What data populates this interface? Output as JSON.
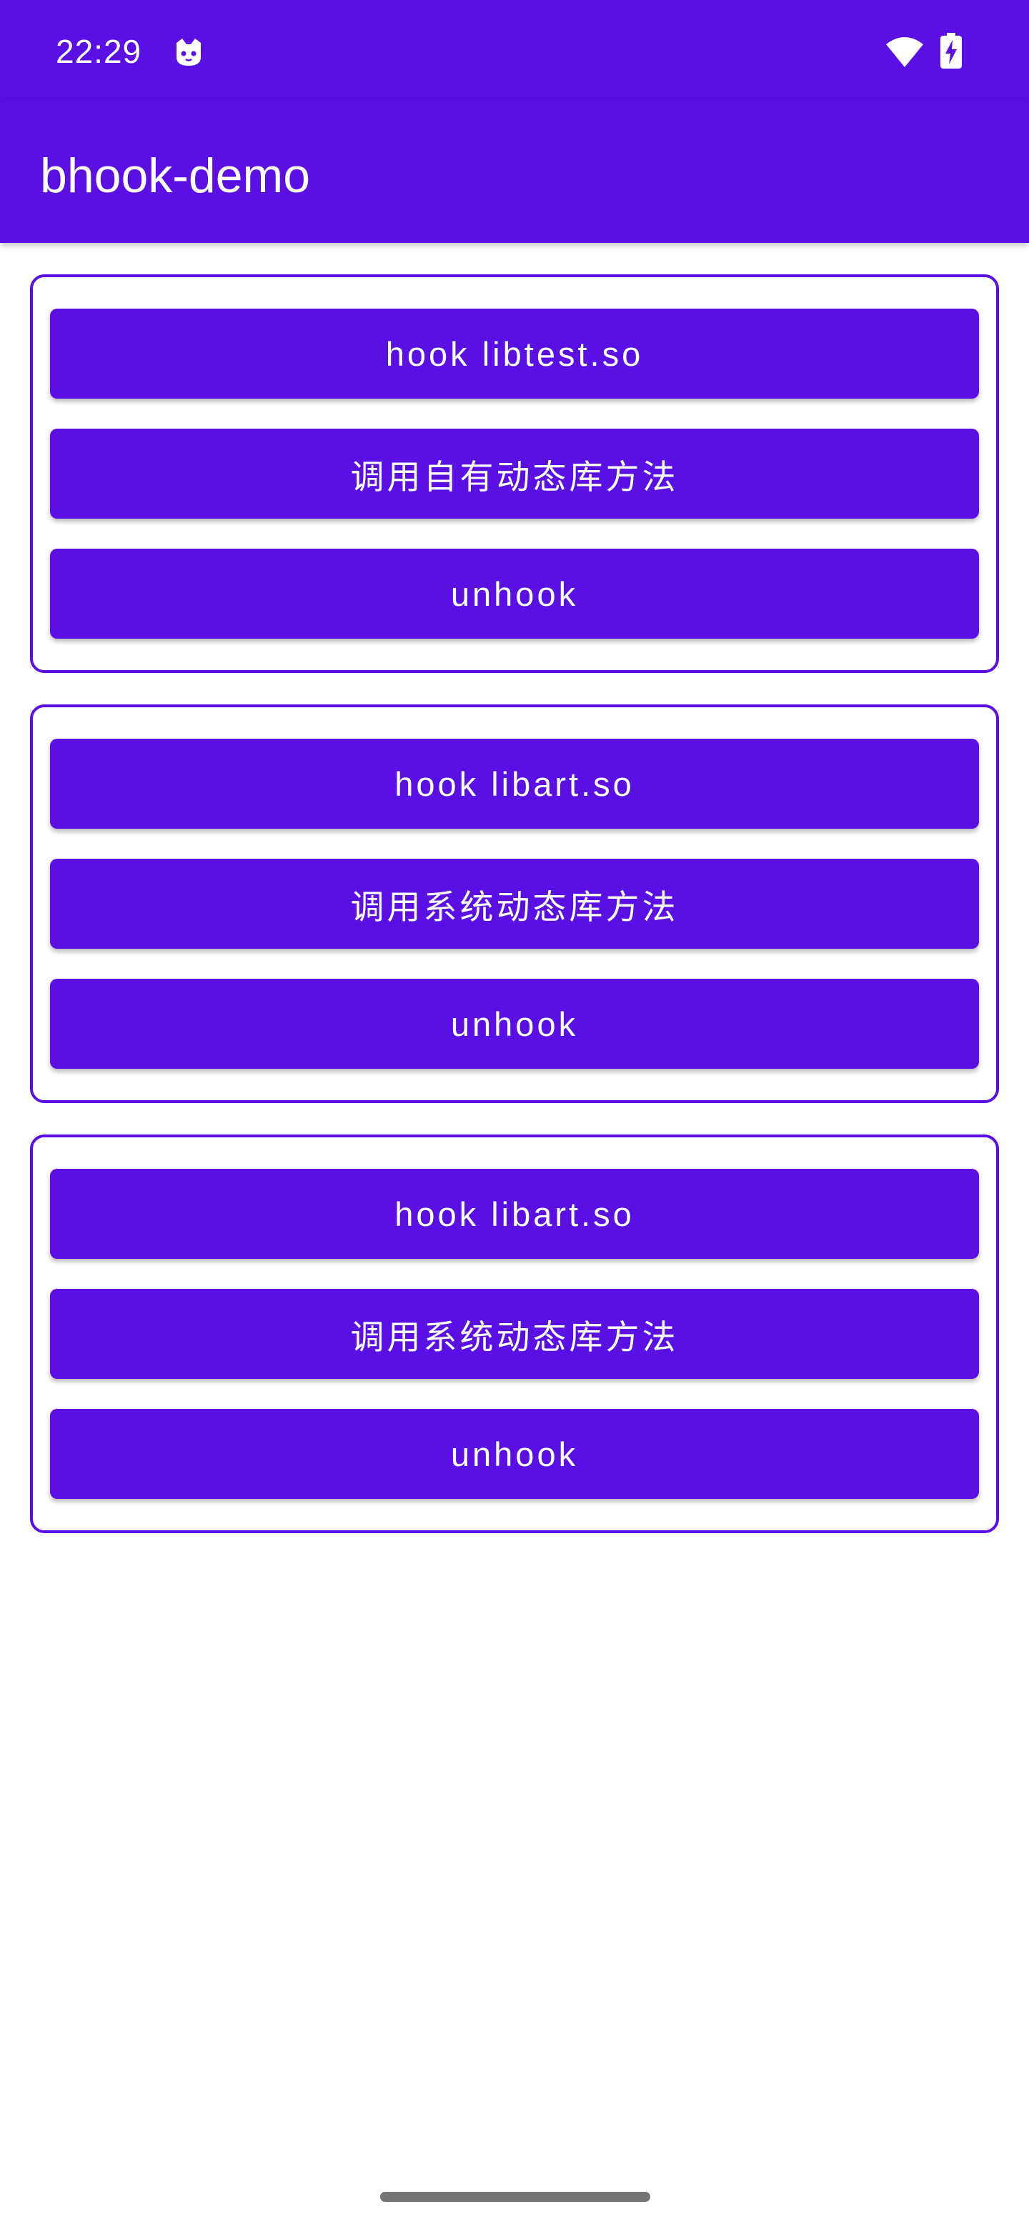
{
  "status_bar": {
    "time": "22:29",
    "icons": [
      "cat-notification-icon",
      "wifi-icon",
      "battery-charging-icon"
    ]
  },
  "app_bar": {
    "title": "bhook-demo"
  },
  "colors": {
    "primary": "#5a0fe3",
    "background": "#ffffff",
    "on_primary": "#ffffff"
  },
  "groups": [
    {
      "buttons": [
        "hook libtest.so",
        "调用自有动态库方法",
        "unhook"
      ]
    },
    {
      "buttons": [
        "hook libart.so",
        "调用系统动态库方法",
        "unhook"
      ]
    },
    {
      "buttons": [
        "hook libart.so",
        "调用系统动态库方法",
        "unhook"
      ]
    }
  ]
}
